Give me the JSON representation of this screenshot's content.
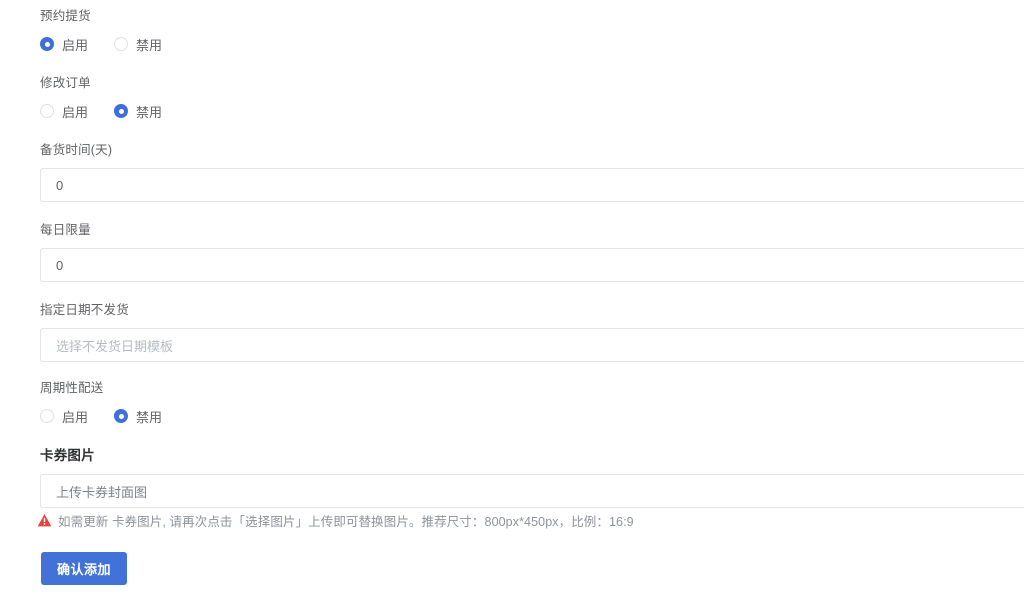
{
  "form": {
    "fields": [
      {
        "label": "预约提货",
        "type": "radio",
        "options": [
          {
            "label": "启用",
            "checked": true
          },
          {
            "label": "禁用",
            "checked": false
          }
        ]
      },
      {
        "label": "修改订单",
        "type": "radio",
        "options": [
          {
            "label": "启用",
            "checked": false
          },
          {
            "label": "禁用",
            "checked": true
          }
        ]
      },
      {
        "label": "备货时间(天)",
        "type": "input",
        "value": "0",
        "placeholder": ""
      },
      {
        "label": "每日限量",
        "type": "input",
        "value": "0",
        "placeholder": ""
      },
      {
        "label": "指定日期不发货",
        "type": "select",
        "value": "",
        "placeholder": "选择不发货日期模板"
      },
      {
        "label": "周期性配送",
        "type": "radio",
        "options": [
          {
            "label": "启用",
            "checked": false
          },
          {
            "label": "禁用",
            "checked": true
          }
        ]
      },
      {
        "label": "卡券图片",
        "type": "upload",
        "value": "",
        "placeholder": "上传卡券封面图"
      }
    ],
    "hint": {
      "icon": "warning-triangle-icon",
      "text": "如需更新 卡券图片, 请再次点击「选择图片」上传即可替换图片。推荐尺寸：800px*450px，比例：16:9"
    },
    "submit_label": "确认添加"
  },
  "colors": {
    "accent": "#4272d7",
    "radio_checked": "#3f6fd8",
    "warning": "#e8423f",
    "label": "#606266",
    "placeholder": "#b6bcc6",
    "border": "#e1e4e8"
  }
}
